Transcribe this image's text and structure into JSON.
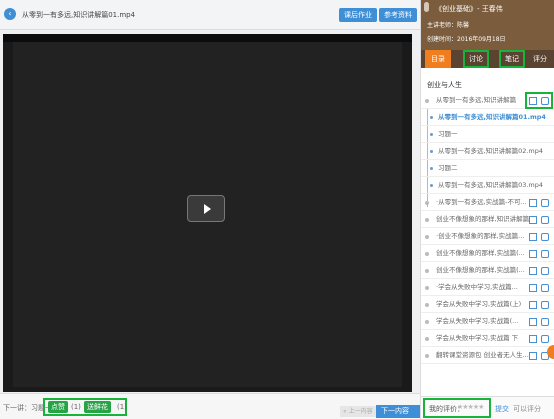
{
  "header": {
    "title": "从零到一有多远,知识讲解篇01.mp4",
    "btn_exercise": "课后作业",
    "btn_material": "参考资料"
  },
  "player": {
    "play_label": "播放"
  },
  "bottom": {
    "next_lesson": "下一讲：习题一",
    "like_label": "点赞",
    "like_count": "(1)",
    "flower_label": "送鲜花",
    "flower_count": "(1)",
    "prev_label": "« 上一内容",
    "next_label": "下一内容 »"
  },
  "panel": {
    "course": "《创业基础》- 王春伟",
    "teacher": "主讲老师：陈馨",
    "created": "创建时间：2016年09月18日",
    "tabs": [
      "目录",
      "讨论",
      "笔记",
      "评分"
    ],
    "section": "创业与人生",
    "items": [
      "从零到一有多远,知识讲解篇",
      "从零到一有多远,知识讲解篇01.mp4",
      "习题一",
      "从零到一有多远,知识讲解篇02.mp4",
      "习题二",
      "从零到一有多远,知识讲解篇03.mp4",
      "·从零到一有多远,实战篇-不可...",
      "创业不像想象的那样,知识讲解篇",
      "·创业不像想象的那样,实战篇...",
      "创业不像想象的那样,实战篇(...",
      "创业不像想象的那样,实战篇(...",
      "·学会从失败中学习,实战篇...",
      "学会从失败中学习,实战篇(上)",
      "学会从失败中学习,实战篇(...",
      "学会从失败中学习,实战篇 下",
      "翻转课堂资源包 创业者无人生..."
    ],
    "rating_label": "我的评价：",
    "stars": "★★★★★",
    "submit": "提交",
    "state": "可以评分"
  }
}
